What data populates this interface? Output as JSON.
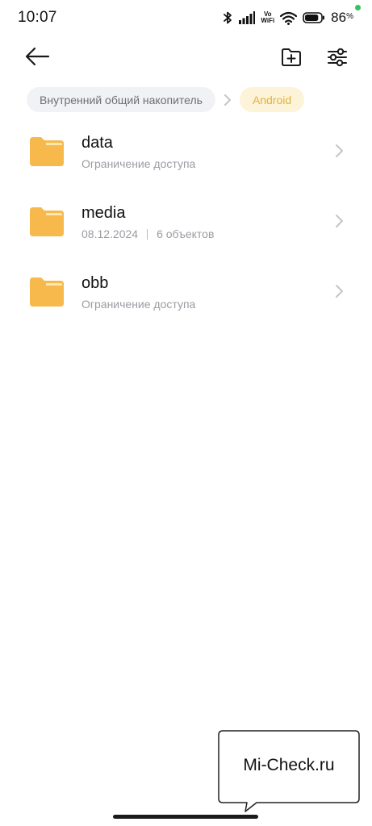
{
  "status_bar": {
    "time": "10:07",
    "vo_label": "Vo",
    "wifi_label": "WiFi",
    "battery_percent": "86",
    "percent_sign": "%",
    "battery_level": 0.86,
    "charging_dot_color": "#33c35a"
  },
  "toolbar": {
    "back_icon": "arrow-left-icon",
    "new_folder_icon": "folder-plus-icon",
    "settings_icon": "sliders-icon"
  },
  "breadcrumb": {
    "root_label": "Внутренний общий накопитель",
    "separator_icon": "chevron-right-icon",
    "current_label": "Android"
  },
  "files": [
    {
      "name": "data",
      "meta": "Ограничение доступа"
    },
    {
      "name": "media",
      "date": "08.12.2024",
      "count": "6 объектов"
    },
    {
      "name": "obb",
      "meta": "Ограничение доступа"
    }
  ],
  "watermark": {
    "text": "Mi-Check.ru"
  },
  "colors": {
    "folder": "#f7b94b",
    "folder_tab": "#fde7b3",
    "accent_chip_bg": "#fdf3d9",
    "accent_chip_text": "#e2b43e",
    "chip_bg": "#f1f2f5"
  }
}
